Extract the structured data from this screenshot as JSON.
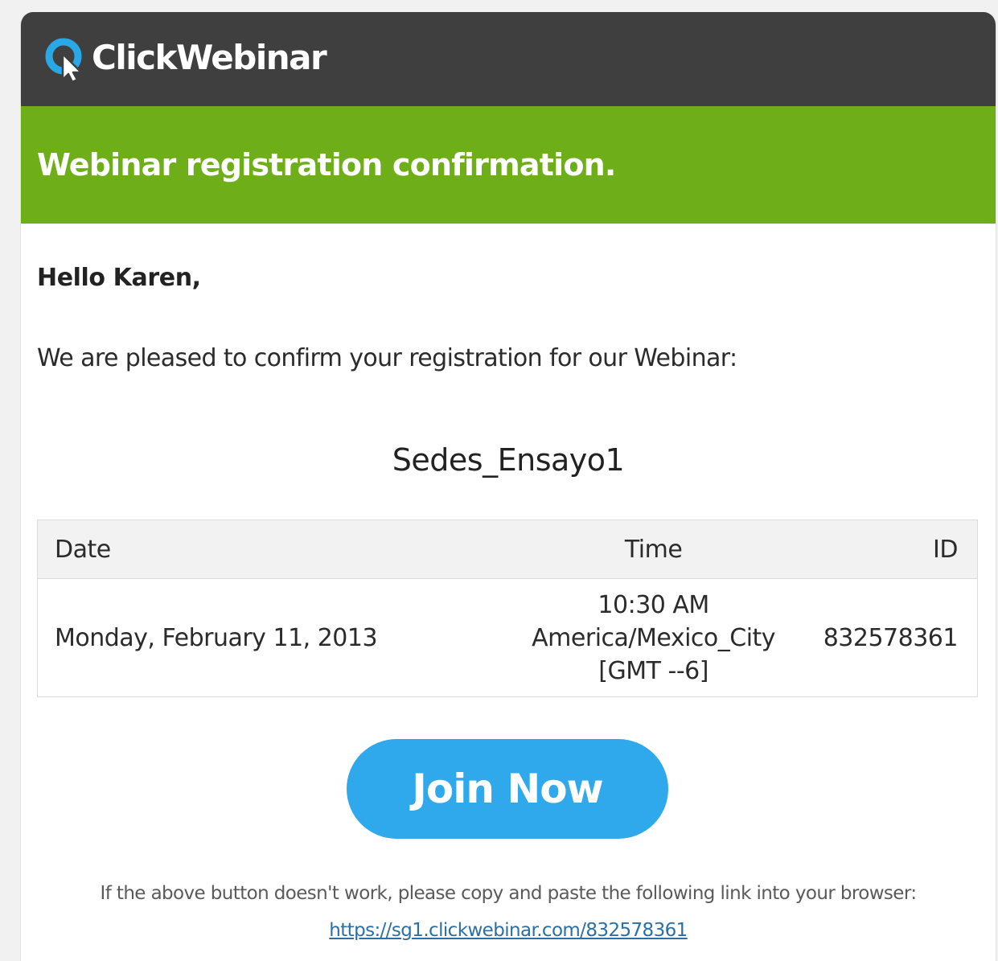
{
  "header": {
    "logo_text": "ClickWebinar",
    "logo_colors": {
      "ring": "#29a8e8",
      "cursor": "#ffffff",
      "bar": "#3f3f3f"
    }
  },
  "banner": {
    "title": "Webinar registration confirmation.",
    "color": "#6eae19"
  },
  "message": {
    "greeting": "Hello Karen,",
    "intro": "We are pleased to confirm your registration for our Webinar:",
    "webinar_name": "Sedes_Ensayo1"
  },
  "details_table": {
    "headers": {
      "date": "Date",
      "time": "Time",
      "id": "ID"
    },
    "row": {
      "date": "Monday, February 11, 2013",
      "time_line1": "10:30 AM",
      "time_line2": "America/Mexico_City",
      "time_line3": "[GMT --6]",
      "id": "832578361"
    }
  },
  "cta": {
    "join_label": "Join Now",
    "color": "#2fa9ec"
  },
  "fallback": {
    "note": "If the above button doesn't work, please copy and paste the following link into your browser:",
    "link_text": "https://sg1.clickwebinar.com/832578361",
    "link_href": "https://sg1.clickwebinar.com/832578361"
  }
}
